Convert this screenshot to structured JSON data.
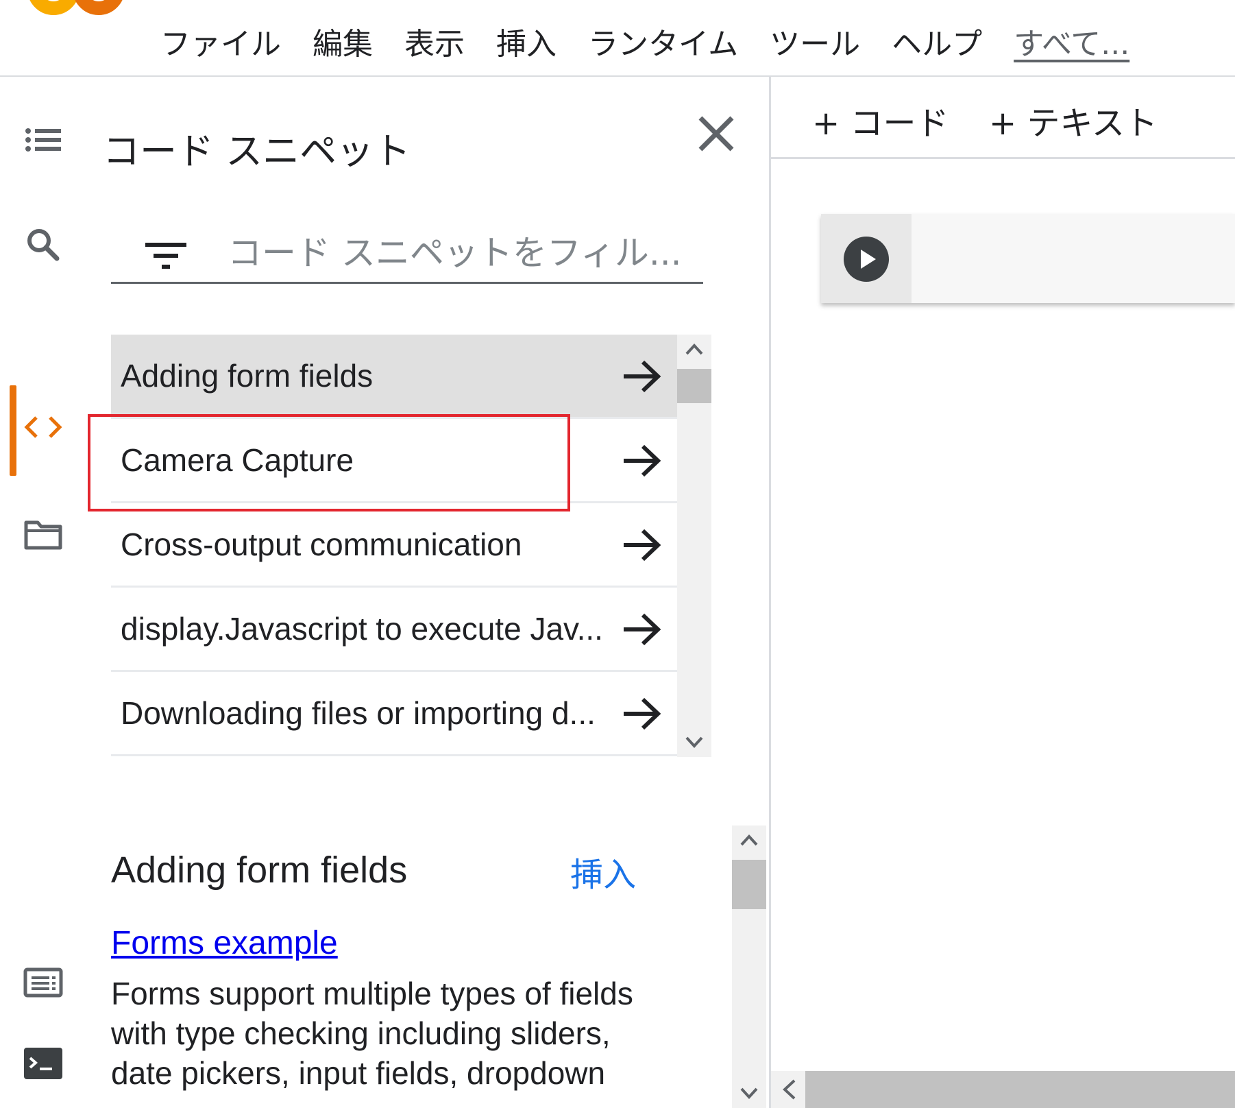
{
  "app": {
    "brand_colors": {
      "accent": "#e8710a",
      "logo_yellow": "#f9ab00",
      "link": "#1a73e8",
      "highlight": "#e3262e"
    }
  },
  "menu": {
    "items": [
      "ファイル",
      "編集",
      "表示",
      "挿入",
      "ランタイム",
      "ツール",
      "ヘルプ"
    ],
    "more_label": "すべて..."
  },
  "rail": {
    "icons": [
      "toc-icon",
      "search-icon",
      "code-icon",
      "folder-icon",
      "command-palette-icon",
      "terminal-icon"
    ],
    "active": "code-icon"
  },
  "snippets_panel": {
    "title": "コード スニペット",
    "filter": {
      "placeholder": "コード スニペットをフィル...",
      "value": ""
    },
    "items": [
      {
        "label": "Adding form fields",
        "selected": true
      },
      {
        "label": "Camera Capture",
        "selected": false
      },
      {
        "label": "Cross-output communication",
        "selected": false
      },
      {
        "label": "display.Javascript to execute Jav...",
        "selected": false
      },
      {
        "label": "Downloading files or importing d...",
        "selected": false
      }
    ]
  },
  "detail": {
    "title": "Adding form fields",
    "insert_label": "挿入",
    "link_label": "Forms example",
    "description": "Forms support multiple types of fields with type checking including sliders, date pickers, input fields, dropdown"
  },
  "notebook": {
    "add_code_label": "+ コード",
    "add_text_label": "+ テキスト"
  }
}
